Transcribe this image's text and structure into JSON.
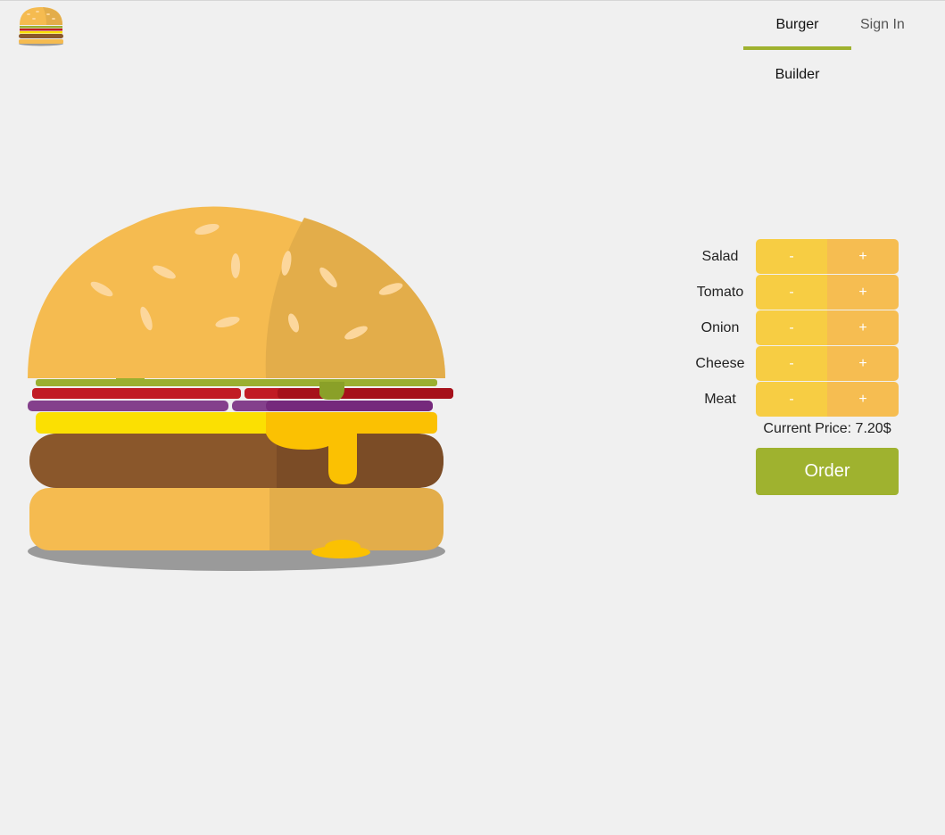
{
  "header": {
    "logo_icon": "burger-logo-icon",
    "nav": [
      {
        "label": "Burger Builder",
        "active": true
      },
      {
        "label": "Sign In",
        "active": false
      }
    ],
    "accent_color": "#9fb22f"
  },
  "controls": {
    "less_label": "-",
    "more_label": "+",
    "ingredients": [
      {
        "label": "Salad"
      },
      {
        "label": "Tomato"
      },
      {
        "label": "Onion"
      },
      {
        "label": "Cheese"
      },
      {
        "label": "Meat"
      }
    ],
    "price_text": "Current Price: 7.20$",
    "order_label": "Order"
  },
  "colors": {
    "bun": "#f5bb50",
    "salad": "#9aaf30",
    "tomato": "#c11b24",
    "onion": "#84408c",
    "cheese": "#fbe002",
    "meat": "#8a572b",
    "less_button": "#f7cd43",
    "more_button": "#f6bd51"
  }
}
